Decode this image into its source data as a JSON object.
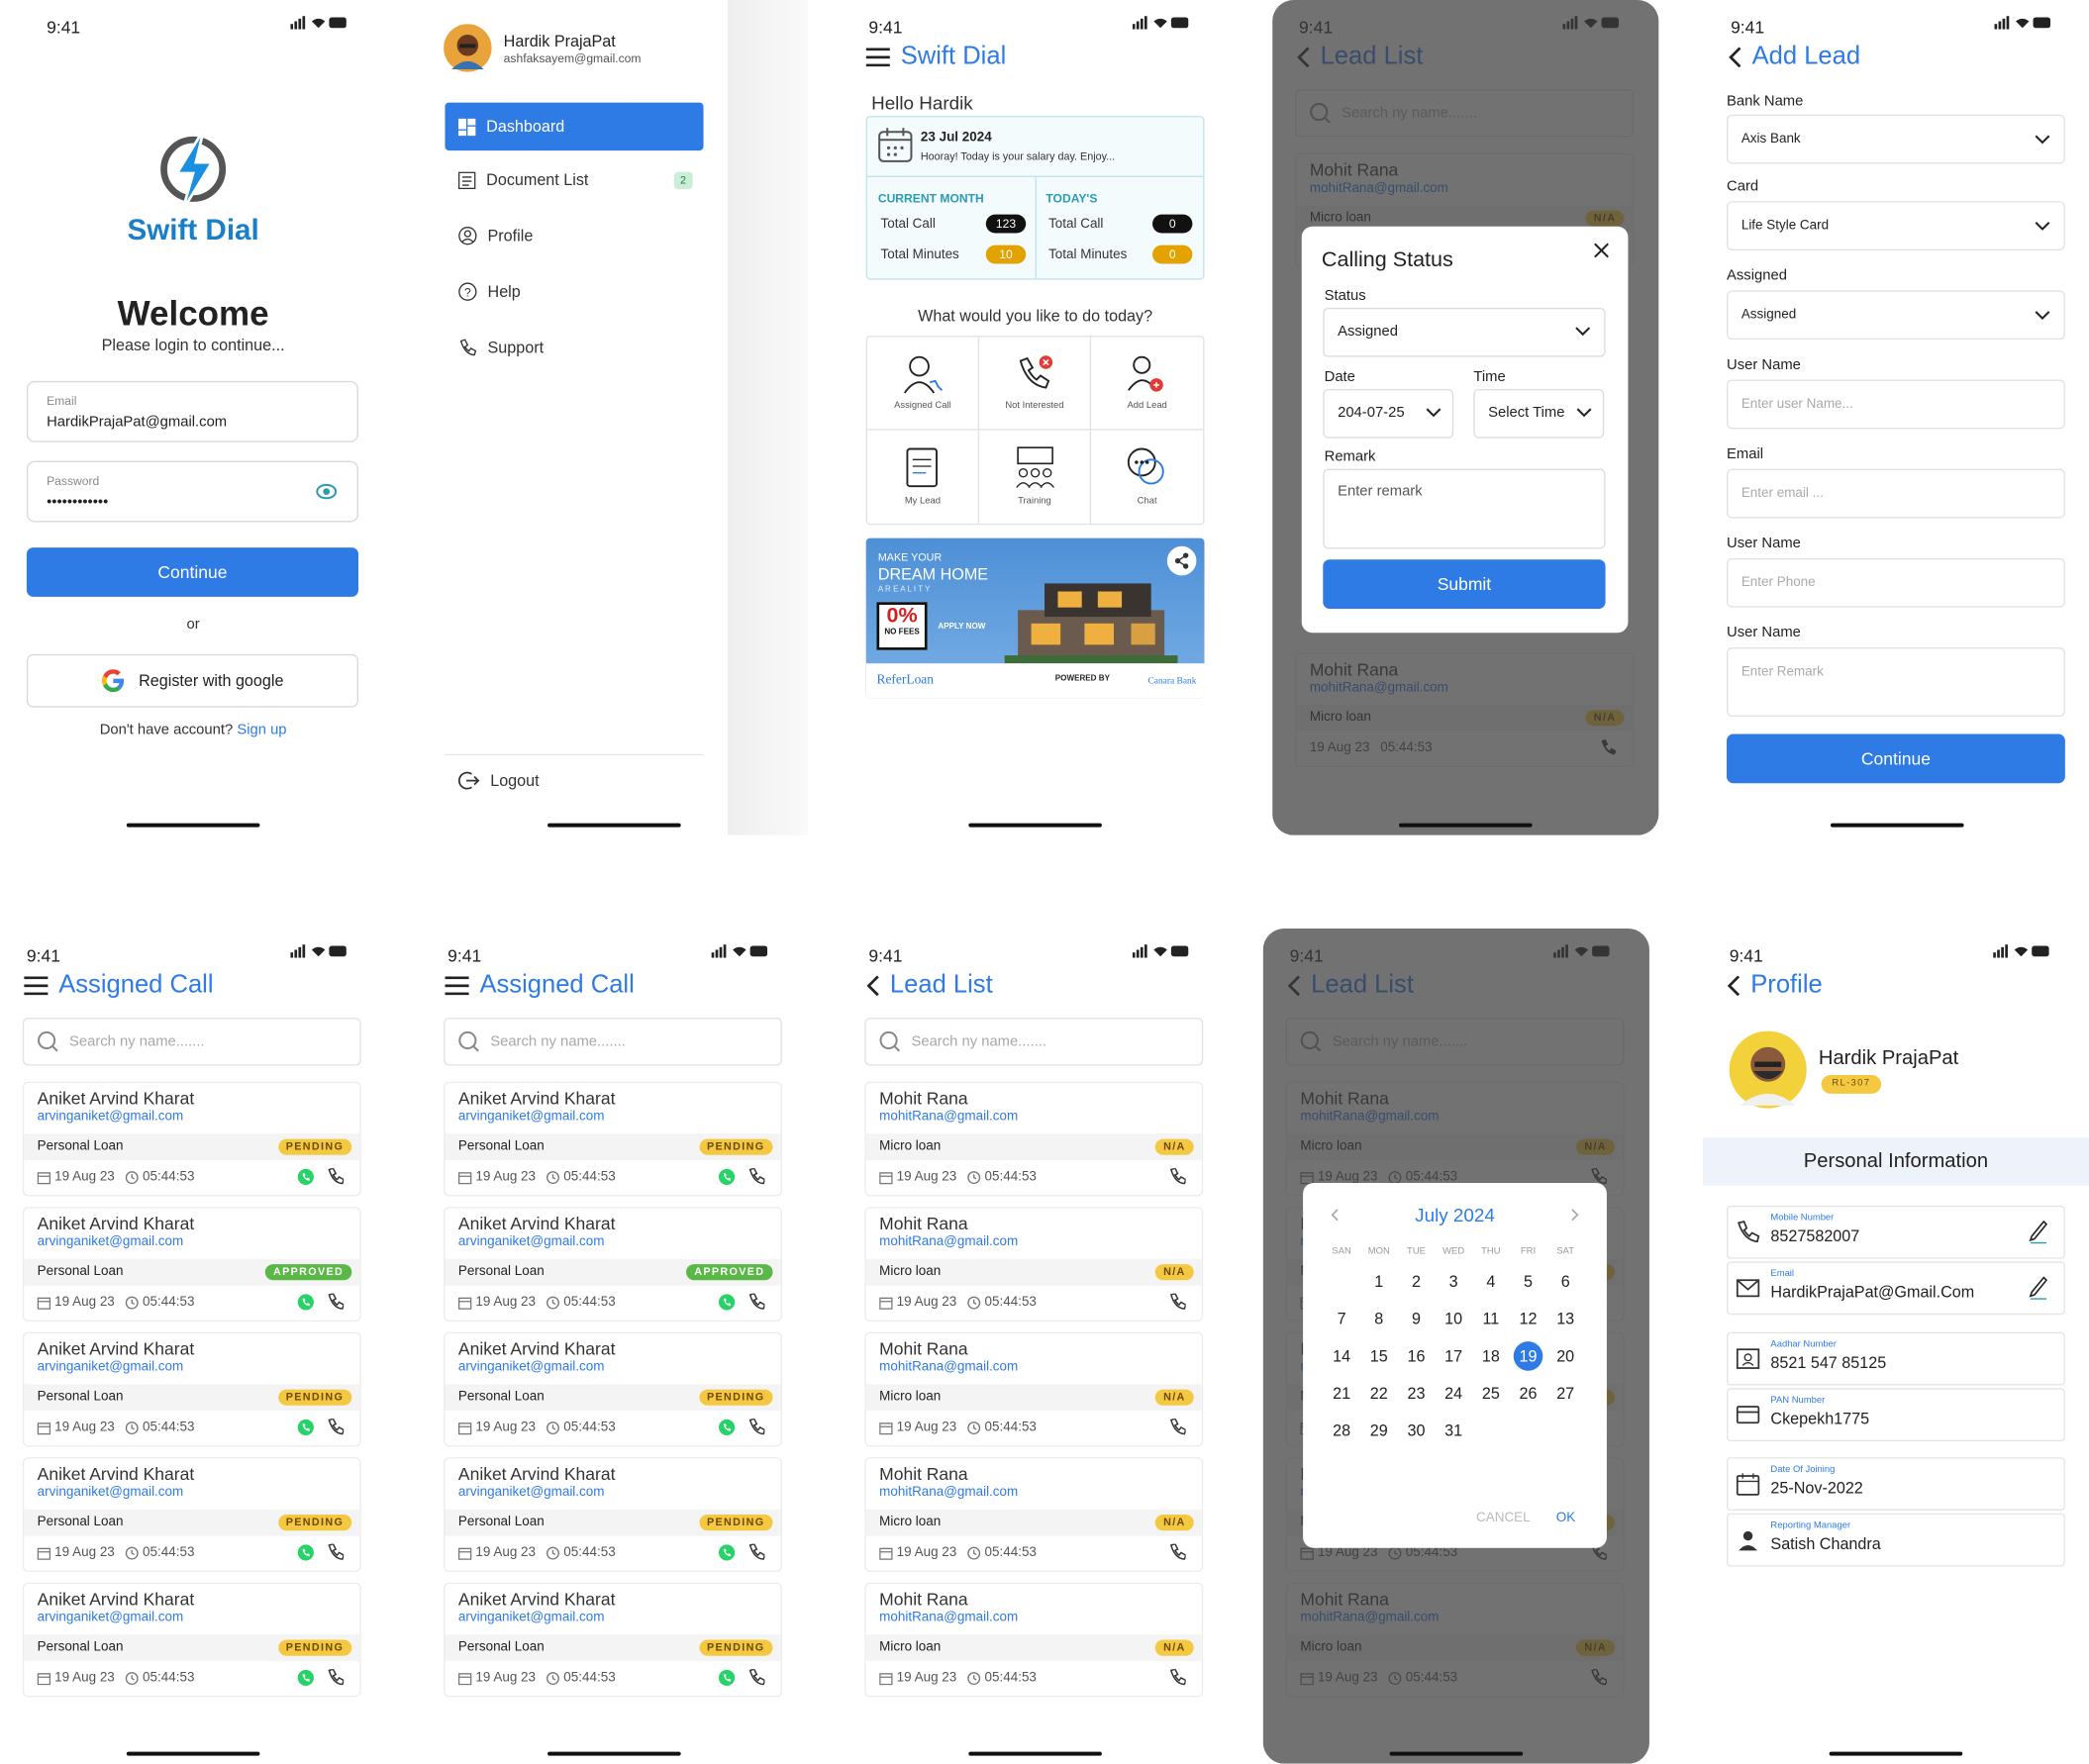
{
  "status_time": "9:41",
  "login": {
    "brand": "Swift Dial",
    "welcome": "Welcome",
    "subtitle": "Please login to continue...",
    "email_label": "Email",
    "email_value": "HardikPrajaPat@gmail.com",
    "password_label": "Password",
    "password_value": "••••••••••••",
    "continue": "Continue",
    "or": "or",
    "google": "Register with google",
    "no_account": "Don't have account?",
    "signup": "Sign up"
  },
  "drawer": {
    "user_name": "Hardik PrajaPat",
    "user_email": "ashfaksayem@gmail.com",
    "items": [
      {
        "label": "Dashboard",
        "icon": "dashboard-icon"
      },
      {
        "label": "Document List",
        "icon": "document-icon",
        "count": "2"
      },
      {
        "label": "Profile",
        "icon": "profile-icon"
      },
      {
        "label": "Help",
        "icon": "help-icon"
      },
      {
        "label": "Support",
        "icon": "phone-icon"
      }
    ],
    "logout": "Logout"
  },
  "dashboard": {
    "title": "Swift Dial",
    "greeting": "Hello Hardik",
    "date": "23 Jul 2024",
    "date_msg": "Hooray! Today is your salary day. Enjoy...",
    "current_month": "CURRENT MONTH",
    "todays": "TODAY'S",
    "total_call": "Total Call",
    "total_minutes": "Total Minutes",
    "month_calls": "123",
    "month_minutes": "10",
    "today_calls": "0",
    "today_minutes": "0",
    "question": "What would you like to do today?",
    "actions": [
      "Assigned Call",
      "Not Interested",
      "Add Lead",
      "My Lead",
      "Training",
      "Chat"
    ],
    "banner_make": "MAKE YOUR",
    "banner_dream": "DREAM HOME",
    "banner_reality": "A R E A L I T Y",
    "banner_zero": "0%",
    "banner_nofees": "NO FEES",
    "banner_apply": "APPLY NOW",
    "banner_refer": "ReferLoan",
    "banner_powered": "POWERED BY",
    "banner_bank": "Canara Bank"
  },
  "lead_list_title": "Lead List",
  "search_placeholder": "Search ny name.......",
  "calling_status": {
    "title": "Calling Status",
    "status_label": "Status",
    "status_value": "Assigned",
    "date_label": "Date",
    "date_value": "204-07-25",
    "time_label": "Time",
    "time_value": "Select Time",
    "remark_label": "Remark",
    "remark_placeholder": "Enter remark",
    "submit": "Submit"
  },
  "add_lead": {
    "title": "Add Lead",
    "bank_label": "Bank Name",
    "bank_value": "Axis Bank",
    "card_label": "Card",
    "card_value": "Life Style Card",
    "assigned_label": "Assigned",
    "assigned_value": "Assigned",
    "username_label": "User Name",
    "username_placeholder": "Enter user Name...",
    "email_label": "Email",
    "email_placeholder": "Enter email ...",
    "username2_label": "User Name",
    "phone_placeholder": "Enter Phone",
    "username3_label": "User Name",
    "remark_placeholder": "Enter Remark",
    "continue": "Continue"
  },
  "assigned_title": "Assigned Call",
  "assigned_cards": [
    {
      "name": "Aniket Arvind Kharat",
      "email": "arvinganiket@gmail.com",
      "type": "Personal Loan",
      "status": "PENDING",
      "date": "19 Aug 23",
      "time": "05:44:53"
    },
    {
      "name": "Aniket Arvind Kharat",
      "email": "arvinganiket@gmail.com",
      "type": "Personal Loan",
      "status": "APPROVED",
      "date": "19 Aug 23",
      "time": "05:44:53"
    },
    {
      "name": "Aniket Arvind Kharat",
      "email": "arvinganiket@gmail.com",
      "type": "Personal Loan",
      "status": "PENDING",
      "date": "19 Aug 23",
      "time": "05:44:53"
    },
    {
      "name": "Aniket Arvind Kharat",
      "email": "arvinganiket@gmail.com",
      "type": "Personal Loan",
      "status": "PENDING",
      "date": "19 Aug 23",
      "time": "05:44:53"
    },
    {
      "name": "Aniket Arvind Kharat",
      "email": "arvinganiket@gmail.com",
      "type": "Personal Loan",
      "status": "PENDING",
      "date": "19 Aug 23",
      "time": "05:44:53"
    }
  ],
  "lead_cards": [
    {
      "name": "Mohit Rana",
      "email": "mohitRana@gmail.com",
      "type": "Micro loan",
      "status": "N/A",
      "date": "19 Aug 23",
      "time": "05:44:53"
    },
    {
      "name": "Mohit Rana",
      "email": "mohitRana@gmail.com",
      "type": "Micro loan",
      "status": "N/A",
      "date": "19 Aug 23",
      "time": "05:44:53"
    },
    {
      "name": "Mohit Rana",
      "email": "mohitRana@gmail.com",
      "type": "Micro loan",
      "status": "N/A",
      "date": "19 Aug 23",
      "time": "05:44:53"
    },
    {
      "name": "Mohit Rana",
      "email": "mohitRana@gmail.com",
      "type": "Micro loan",
      "status": "N/A",
      "date": "19 Aug 23",
      "time": "05:44:53"
    },
    {
      "name": "Mohit Rana",
      "email": "mohitRana@gmail.com",
      "type": "Micro loan",
      "status": "N/A",
      "date": "19 Aug 23",
      "time": "05:44:53"
    }
  ],
  "calendar": {
    "month": "July 2024",
    "days": [
      "SAN",
      "MON",
      "TUE",
      "WED",
      "THU",
      "FRI",
      "SAT"
    ],
    "selected": "19",
    "cancel": "CANCEL",
    "ok": "OK"
  },
  "profile": {
    "title": "Profile",
    "name": "Hardik PrajaPat",
    "code": "RL-307",
    "section": "Personal Information",
    "fields": [
      {
        "label": "Mobile Number",
        "value": "8527582007"
      },
      {
        "label": "Email",
        "value": "HardikPrajaPat@Gmail.Com"
      },
      {
        "label": "Aadhar Number",
        "value": "8521 547 85125"
      },
      {
        "label": "PAN Number",
        "value": "Ckepekh1775"
      },
      {
        "label": "Date Of Joining",
        "value": "25-Nov-2022"
      },
      {
        "label": "Reporting Manager",
        "value": "Satish Chandra"
      }
    ]
  },
  "colors": {
    "accent": "#2e7be6",
    "pending": "#f5c842",
    "approved": "#59b846"
  }
}
